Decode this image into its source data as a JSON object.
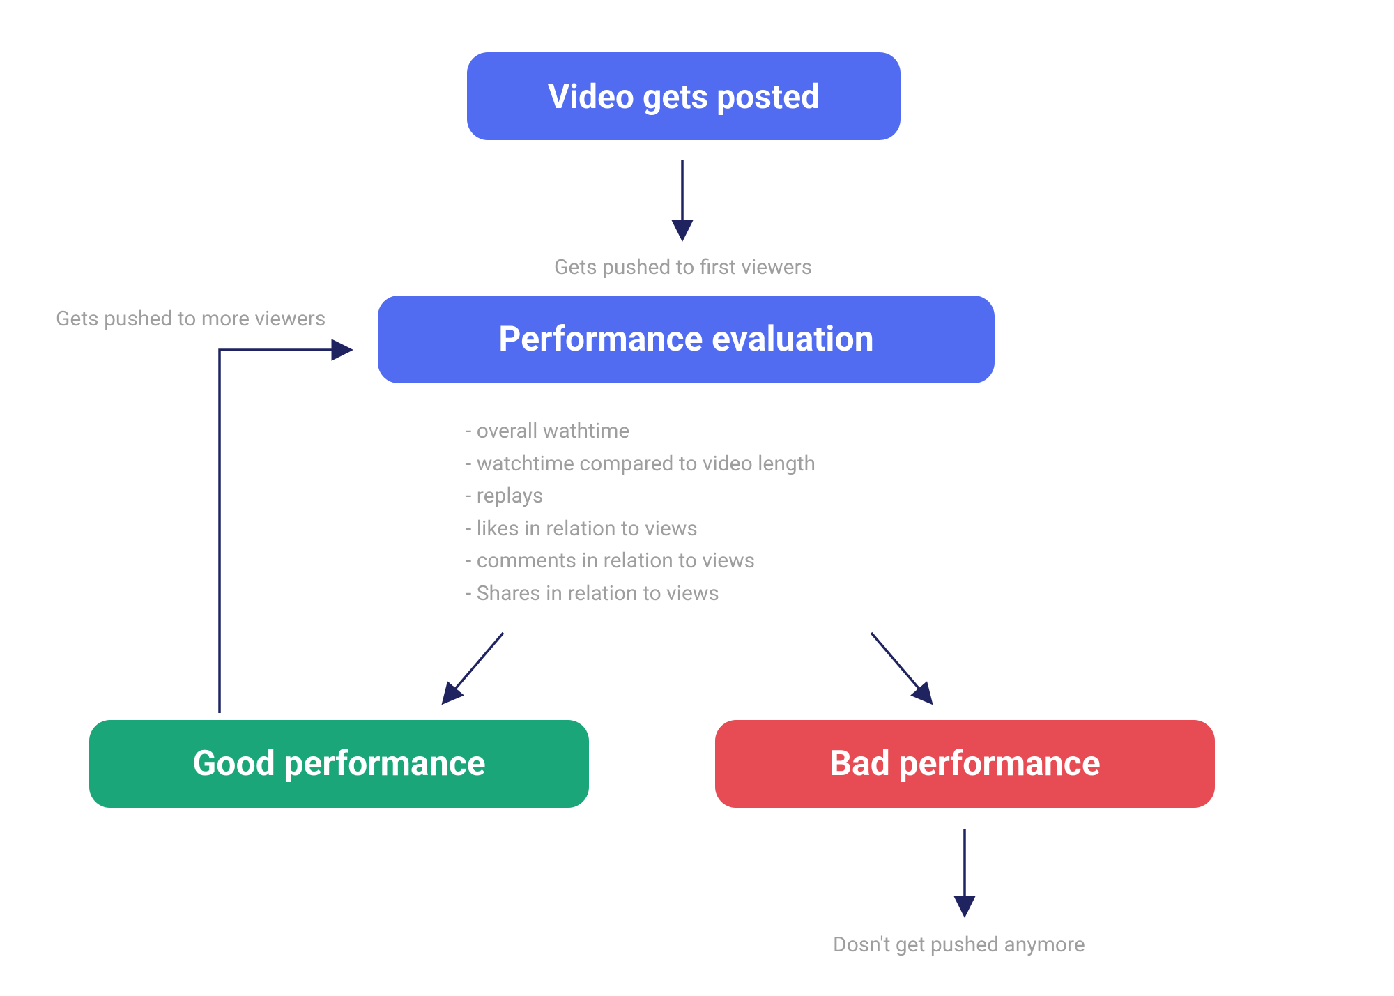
{
  "nodes": {
    "posted": {
      "text": "Video gets posted",
      "bg": "#516CF0"
    },
    "eval": {
      "text": "Performance evaluation",
      "bg": "#516CF0"
    },
    "good": {
      "text": "Good performance",
      "bg": "#1BA67A"
    },
    "bad": {
      "text": "Bad performance",
      "bg": "#E74C54"
    }
  },
  "labels": {
    "first_viewers": "Gets pushed to first viewers",
    "more_viewers": "Gets pushed to more viewers",
    "not_pushed": "Dosn't get pushed anymore"
  },
  "criteria": [
    "- overall wathtime",
    "- watchtime compared to video length",
    "- replays",
    "- likes in relation to views",
    "- comments in relation to views",
    "- Shares in relation to views"
  ],
  "arrow_color": "#1F2460"
}
